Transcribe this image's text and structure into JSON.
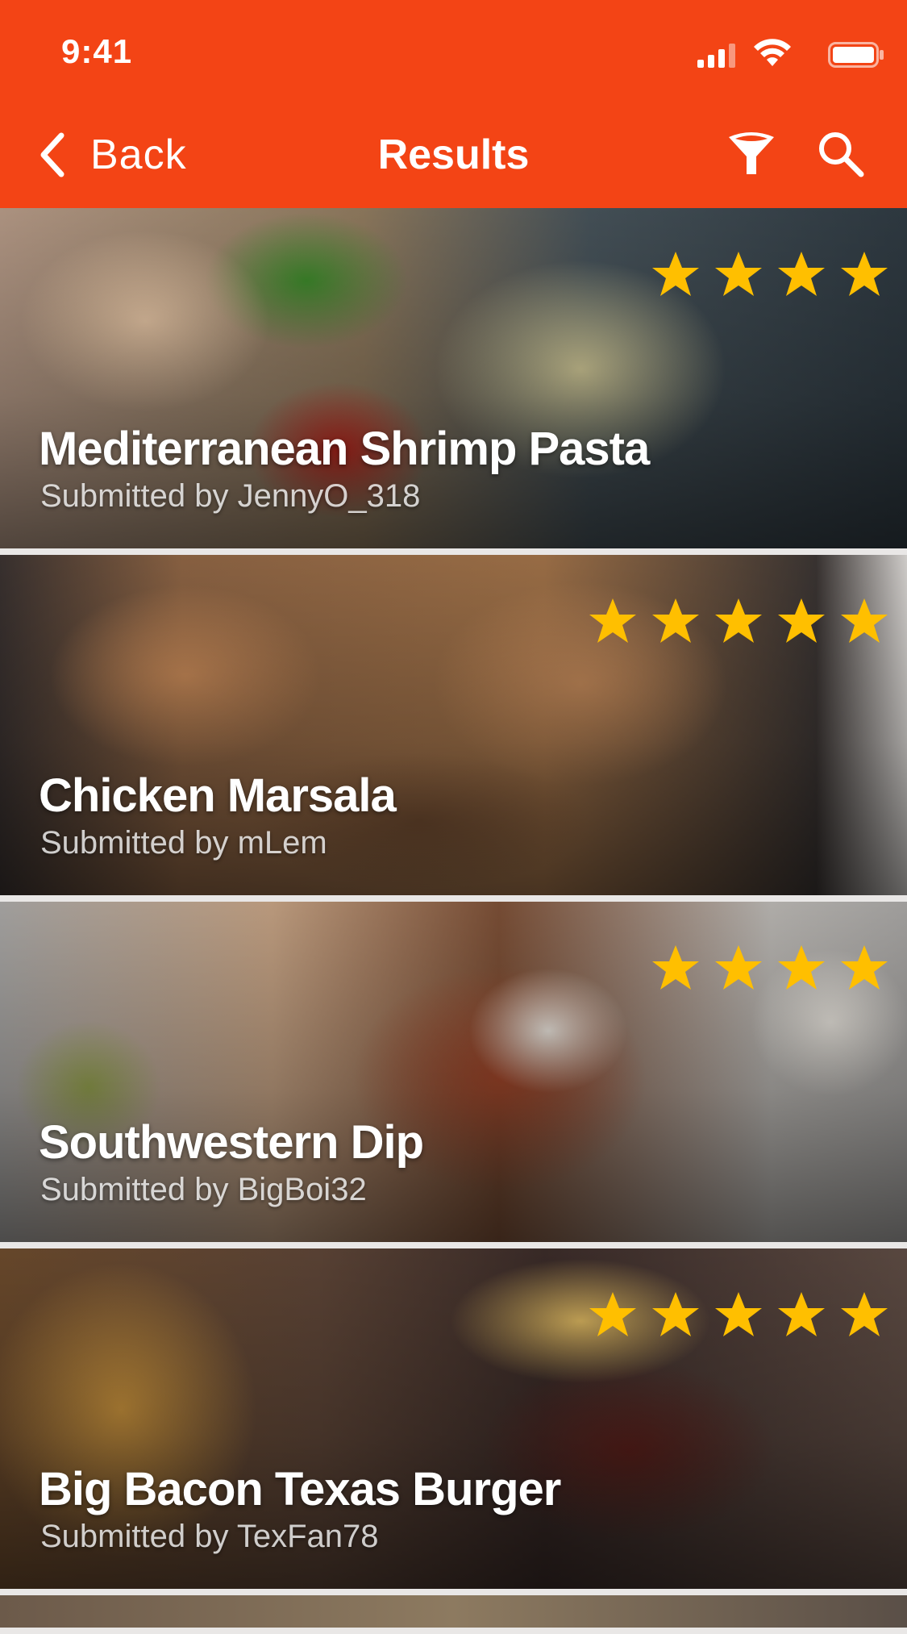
{
  "status_bar": {
    "time": "9:41"
  },
  "nav": {
    "back_label": "Back",
    "title": "Results",
    "icons": [
      "chevron-left-icon",
      "filter-icon",
      "search-icon"
    ]
  },
  "colors": {
    "accent": "#f34415",
    "star": "#ffbf00"
  },
  "recipes": [
    {
      "title": "Mediterranean Shrimp Pasta",
      "submitted_by": "Submitted by JennyO_318",
      "rating": 4
    },
    {
      "title": "Chicken Marsala",
      "submitted_by": "Submitted by mLem",
      "rating": 5
    },
    {
      "title": "Southwestern Dip",
      "submitted_by": "Submitted by BigBoi32",
      "rating": 4
    },
    {
      "title": "Big Bacon Texas Burger",
      "submitted_by": "Submitted by TexFan78",
      "rating": 5
    }
  ]
}
